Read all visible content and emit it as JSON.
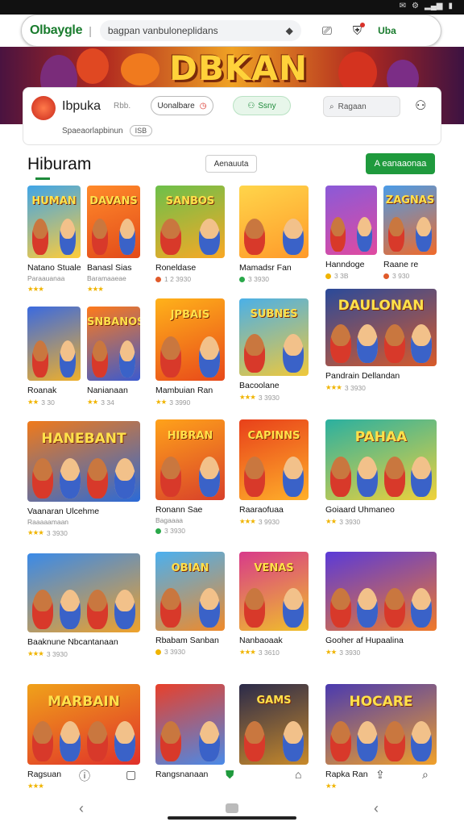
{
  "browser": {
    "brand": "Olbaygle",
    "url": "bagpan vanbuloneplidans",
    "live_label": "Uba",
    "status_icons": [
      "✆",
      "⚙",
      "▦",
      "▮"
    ]
  },
  "banner": {
    "title": "DBKAN"
  },
  "header": {
    "site_name": "Ibpuka",
    "sub_label": "Rbb.",
    "dropdown_label": "Uonalbare",
    "green_button_label": "Ssny",
    "search_placeholder": "Ragaan",
    "breadcrumb_text": "Spaeaorlapbinun",
    "breadcrumb_pill": "ISB"
  },
  "section": {
    "title": "Hiburam",
    "filter_label": "Aenauuta",
    "cta_label": "A eanaaonaa"
  },
  "games": [
    {
      "title": "Natano Stuale",
      "sub": "Paraauanaa",
      "meta": "",
      "rating": "★★★",
      "thumb_text": "HUMAN"
    },
    {
      "title": "Banasl Sias",
      "sub": "Baramaaeae",
      "meta": "",
      "rating": "★★★",
      "thumb_text": "DAVANS"
    },
    {
      "title": "Roneldase",
      "sub": "",
      "meta": "1 2 3930",
      "rating": "",
      "thumb_text": "SANBOS"
    },
    {
      "title": "Mamadsr Fan",
      "sub": "",
      "meta": "3 3930",
      "rating": "",
      "thumb_text": ""
    },
    {
      "title": "Hanndoge",
      "sub": "",
      "meta": "3 3B",
      "rating": "",
      "thumb_text": ""
    },
    {
      "title": "Raane re",
      "sub": "",
      "meta": "3 930",
      "rating": "",
      "thumb_text": "ZAGNAS"
    },
    {
      "title": "Roanak",
      "sub": "",
      "meta": "3 30",
      "rating": "★★",
      "thumb_text": ""
    },
    {
      "title": "Nanianaan",
      "sub": "",
      "meta": "3 34",
      "rating": "★★",
      "thumb_text": "SNBANOS"
    },
    {
      "title": "Mambuian Ran",
      "sub": "",
      "meta": "3 3990",
      "rating": "★★",
      "thumb_text": "JPBAIS"
    },
    {
      "title": "Bacoolane",
      "sub": "",
      "meta": "3 3930",
      "rating": "★★★",
      "thumb_text": "SUBNES"
    },
    {
      "title": "Pandrain Dellandan",
      "sub": "",
      "meta": "3 3930",
      "rating": "★★★",
      "thumb_text": "DAULONAN"
    },
    {
      "title": "Vaanaran Ulcehme",
      "sub": "Raaaaamaan",
      "meta": "3 3930",
      "rating": "★★★",
      "thumb_text": "HANEBANT"
    },
    {
      "title": "Ronann Sae",
      "sub": "Bagaaaa",
      "meta": "3 3930",
      "rating": "",
      "thumb_text": "HIBRAN"
    },
    {
      "title": "Raaraofuaa",
      "sub": "",
      "meta": "3 9930",
      "rating": "★★★",
      "thumb_text": "CAPINNS"
    },
    {
      "title": "Goiaard Uhmaneo",
      "sub": "",
      "meta": "3 3930",
      "rating": "★★",
      "thumb_text": "PAHAA"
    },
    {
      "title": "Baaknune Nbcantanaan",
      "sub": "",
      "meta": "3 3930",
      "rating": "★★★",
      "thumb_text": ""
    },
    {
      "title": "Rbabam Sanban",
      "sub": "",
      "meta": "3 3930",
      "rating": "",
      "thumb_text": "OBIAN"
    },
    {
      "title": "Nanbaoaak",
      "sub": "",
      "meta": "3 3610",
      "rating": "★★★",
      "thumb_text": "VENAS"
    },
    {
      "title": "Gooher af Hupaalina",
      "sub": "",
      "meta": "3 3930",
      "rating": "★★",
      "thumb_text": ""
    },
    {
      "title": "Ragsuan",
      "sub": "",
      "meta": "",
      "rating": "★★★",
      "thumb_text": "MARBAIN"
    },
    {
      "title": "Rangsnanaan",
      "sub": "",
      "meta": "",
      "rating": "",
      "thumb_text": ""
    },
    {
      "title": "",
      "sub": "",
      "meta": "",
      "rating": "",
      "thumb_text": "GAMS"
    },
    {
      "title": "Rapka Ran",
      "sub": "",
      "meta": "",
      "rating": "★★",
      "thumb_text": "HOCARE"
    }
  ],
  "colors": {
    "accent": "#1f9a3d",
    "star": "#f0b400",
    "banner_title": "#ffd23a"
  }
}
